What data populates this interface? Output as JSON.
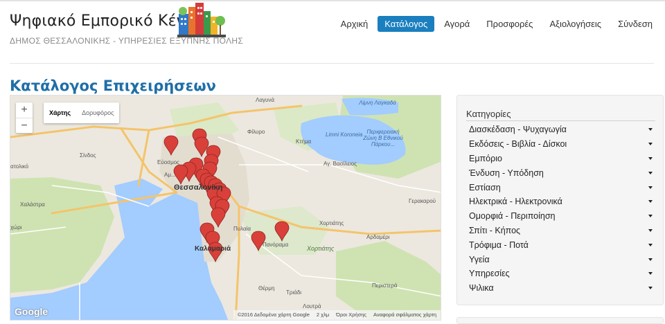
{
  "header": {
    "title": "Ψηφιακό Εμπορικό Κέντρο",
    "subtitle": "ΔΗΜΟΣ ΘΕΣΣΑΛΟΝΙΚΗΣ - ΥΠΗΡΕΣΙΕΣ ΕΞΥΠΝΗΣ ΠΟΛΗΣ",
    "logo": "city-buildings-logo"
  },
  "nav": {
    "items": [
      {
        "label": "Αρχική",
        "active": false
      },
      {
        "label": "Κατάλογος",
        "active": true
      },
      {
        "label": "Αγορά",
        "active": false
      },
      {
        "label": "Προσφορές",
        "active": false
      },
      {
        "label": "Αξιολογήσεις",
        "active": false
      },
      {
        "label": "Σύνδεση",
        "active": false
      }
    ],
    "active_color": "#1a7fbf"
  },
  "page_title": "Κατάλογος Επιχειρήσεων",
  "map": {
    "zoom_in": "+",
    "zoom_out": "−",
    "type_map": "Χάρτης",
    "type_satellite": "Δορυφόρος",
    "google": "Google",
    "copyright": "©2016 Δεδομένα χάρτη Google",
    "scale": "2 χλμ",
    "terms": "Όροι Χρήσης",
    "report": "Αναφορά σφάλματος χάρτη",
    "labels": {
      "lagyna": "Λαγυνά",
      "limni_lagada": "Λίμνη Λαγκαδά",
      "limni_koroneia": "Limni Koroneia",
      "periferiaki": "Περιφερειακή Ζώνη Β Εθνικού Πάρκου...",
      "filyro": "Φίλυρο",
      "ktima": "Κτήμα",
      "ag_vasileios": "Αγ. Βασίλειος",
      "sindos": "Σίνδος",
      "evosmos": "Εύοσμος",
      "ampelokipoi": "Αμ...",
      "thessaloniki": "Θεσσαλονίκη",
      "atoliko": "ατολικό",
      "chalastra": "Χαλάστρα",
      "kalochori": "χώρι",
      "pylaia": "Πυλαία",
      "kalamaria": "Καλαμαριά",
      "panorama": "Πανόραμα",
      "chortiatis": "Χορτιάτης",
      "chortiatis2": "Χορτιάτης",
      "ardameri": "Αρδαμέρι",
      "gerakarou": "Γερακαρού",
      "peristera": "Περιστερά",
      "thermi": "Θέρμη",
      "triadi": "Τριάδι",
      "loutra": "Λουτρά"
    }
  },
  "categories": {
    "title": "Κατηγορίες",
    "items": [
      "Διασκέδαση - Ψυχαγωγία",
      "Εκδόσεις - Βιβλία - Δίσκοι",
      "Εμπόριο",
      "Ένδυση - Υπόδηση",
      "Εστίαση",
      "Ηλεκτρικά - Ηλεκτρονικά",
      "Ομορφιά - Περιποίηση",
      "Σπίτι - Κήπος",
      "Τρόφιμα - Ποτά",
      "Υγεία",
      "Υπηρεσίες",
      "Ψιλικα"
    ]
  },
  "colors": {
    "title_blue": "#1f6fa8",
    "marker_red": "#d9403a",
    "water": "#a3ccff",
    "park": "#c8dfa5"
  }
}
